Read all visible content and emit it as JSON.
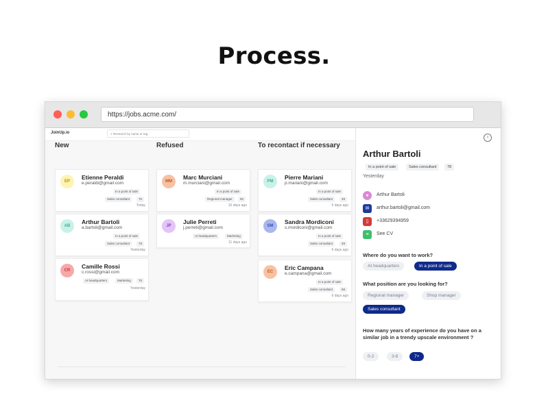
{
  "hero_title": "Process.",
  "browser": {
    "url": "https://jobs.acme.com/"
  },
  "app": {
    "logo": "JoinUp.io",
    "search_placeholder": "Research by name or tag"
  },
  "columns": [
    {
      "title": "New",
      "cards": [
        {
          "initials": "EP",
          "avatar_bg": "#fff3b3",
          "avatar_fg": "#b39500",
          "name": "Etienne Peraldi",
          "email": "e.peraldi@gmail.com",
          "tags": [
            "In a point of sale",
            "Sales consultant"
          ],
          "years": "75",
          "date": "Today"
        },
        {
          "initials": "AB",
          "avatar_bg": "#c9f1e9",
          "avatar_fg": "#3fae95",
          "name": "Arthur Bartoli",
          "email": "a.bartoli@gmail.com",
          "tags": [
            "In a point of sale",
            "Sales consultant"
          ],
          "years": "78",
          "date": "Yesterday"
        },
        {
          "initials": "CR",
          "avatar_bg": "#f7a8a8",
          "avatar_fg": "#c23b3b",
          "name": "Camille Rossi",
          "email": "c.rossi@gmail.com",
          "tags": [
            "At headquarters",
            "Marketing"
          ],
          "years": "75",
          "date": "Yesterday"
        }
      ]
    },
    {
      "title": "Refused",
      "cards": [
        {
          "initials": "MM",
          "avatar_bg": "#f9c1a3",
          "avatar_fg": "#c0572a",
          "name": "Marc Murciani",
          "email": "m.murciani@gmail.com",
          "tags": [
            "In a point of sale",
            "Regional manager"
          ],
          "years": "92",
          "date": "10 days ago"
        },
        {
          "initials": "JP",
          "avatar_bg": "#e3c4f6",
          "avatar_fg": "#8e3fbf",
          "name": "Julie Perreti",
          "email": "j.perreti@gmail.com",
          "tags": [
            "At headquarters",
            "Marketing"
          ],
          "years": "",
          "date": "11 days ago"
        }
      ]
    },
    {
      "title": "To recontact if necessary",
      "cards": [
        {
          "initials": "PM",
          "avatar_bg": "#c9f1e9",
          "avatar_fg": "#3fae95",
          "name": "Pierre Mariani",
          "email": "p.mariani@gmail.com",
          "tags": [
            "In a point of sale",
            "Sales consultant"
          ],
          "years": "49",
          "date": "5 days ago"
        },
        {
          "initials": "SM",
          "avatar_bg": "#a9b7ec",
          "avatar_fg": "#3a4fb0",
          "name": "Sandra Mordiconi",
          "email": "s.mordiconi@gmail.com",
          "tags": [
            "In a point of sale",
            "Sales consultant"
          ],
          "years": "49",
          "date": "6 days ago"
        },
        {
          "initials": "EC",
          "avatar_bg": "#f9c1a3",
          "avatar_fg": "#c0572a",
          "name": "Eric Campana",
          "email": "e.campana@gmail.com",
          "tags": [
            "In a point of sale",
            "Sales consultant"
          ],
          "years": "69",
          "date": "6 days ago"
        }
      ]
    }
  ],
  "profile": {
    "name": "Arthur Bartoli",
    "tags": [
      "In a point of sale",
      "Sales consultant",
      "78"
    ],
    "date": "Yesterday",
    "info": [
      {
        "icon": "person-icon",
        "color": "#d98ad6",
        "text": "Arthur Bartoli"
      },
      {
        "icon": "email-icon",
        "color": "#1f3a9e",
        "text": "arthur.bartoli@gmail.com"
      },
      {
        "icon": "phone-icon",
        "color": "#d23a3a",
        "text": "+33629394959"
      },
      {
        "icon": "cv-icon",
        "color": "#3fbf6b",
        "text": "See CV"
      }
    ],
    "questions": [
      {
        "text": "Where do you want to work?",
        "options": [
          {
            "label": "At headquarters",
            "selected": false
          },
          {
            "label": "In a point of sale",
            "selected": true
          }
        ]
      },
      {
        "text": "What position are you looking for?",
        "options": [
          {
            "label": "Regional manager",
            "selected": false
          },
          {
            "label": "Shop manager",
            "selected": false
          },
          {
            "label": "Sales consultant",
            "selected": true
          }
        ]
      },
      {
        "text": "How many years of experience do you have on a similar job in a trendy upscale environment ?",
        "options": [
          {
            "label": "0-2",
            "selected": false
          },
          {
            "label": "3-6",
            "selected": false
          },
          {
            "label": "7+",
            "selected": true
          }
        ]
      }
    ]
  }
}
